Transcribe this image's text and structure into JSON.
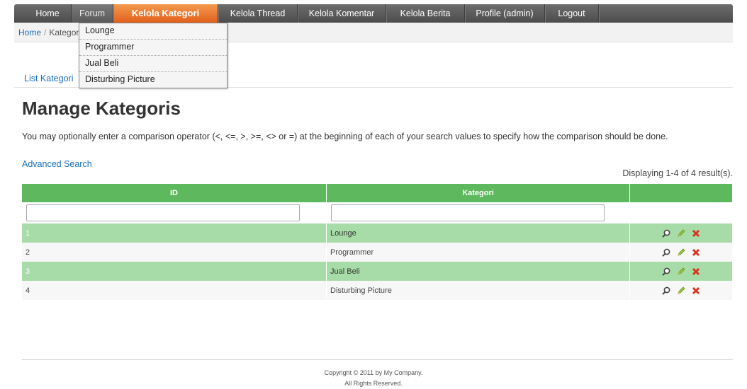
{
  "nav": {
    "items": [
      "Home",
      "Forum",
      "Kelola Kategori",
      "Kelola Thread",
      "Kelola Komentar",
      "Kelola Berita",
      "Profile (admin)",
      "Logout"
    ]
  },
  "breadcrumb": {
    "home": "Home",
    "separator": "/",
    "current": "Kategoris"
  },
  "dropdown": {
    "items": [
      "Lounge",
      "Programmer",
      "Jual Beli",
      "Disturbing Picture"
    ]
  },
  "operations": {
    "list_label": "List Kategori"
  },
  "page": {
    "title": "Manage Kategoris",
    "hint": "You may optionally enter a comparison operator (<, <=, >, >=, <> or =) at the beginning of each of your search values to specify how the comparison should be done.",
    "advanced_search": "Advanced Search",
    "summary": "Displaying 1-4 of 4 result(s)."
  },
  "grid": {
    "columns": [
      "ID",
      "Kategori",
      ""
    ],
    "filter_values": [
      "",
      ""
    ],
    "rows": [
      {
        "id": "1",
        "kategori": "Lounge"
      },
      {
        "id": "2",
        "kategori": "Programmer"
      },
      {
        "id": "3",
        "kategori": "Jual Beli"
      },
      {
        "id": "4",
        "kategori": "Disturbing Picture"
      }
    ],
    "action_icons": [
      "view-icon",
      "update-icon",
      "delete-icon"
    ]
  },
  "footer": {
    "line1": "Copyright © 2011 by My Company.",
    "line2": "All Rights Reserved."
  },
  "colors": {
    "nav_bg": "#5a5a5a",
    "active_tab": "#ea7a2f",
    "grid_header": "#5eb95e",
    "grid_odd_row": "#a7dba7",
    "link": "#1c6fb8"
  }
}
